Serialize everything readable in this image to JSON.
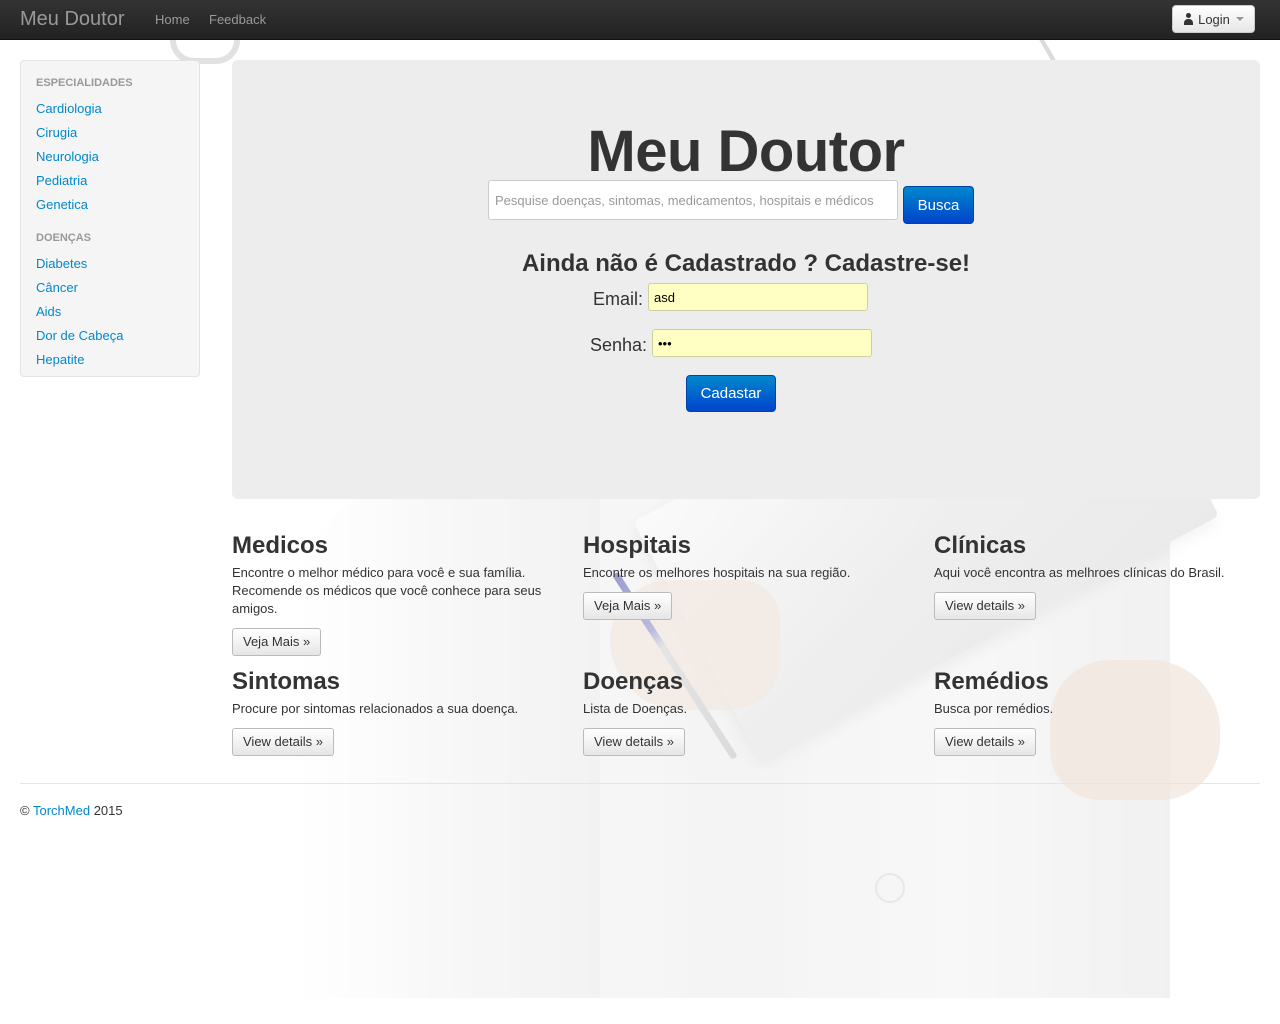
{
  "navbar": {
    "brand": "Meu Doutor",
    "links": [
      "Home",
      "Feedback"
    ],
    "login_label": "Login",
    "login_icon": "user-icon",
    "caret_icon": "caret-down-icon"
  },
  "sidebar": {
    "sections": [
      {
        "header": "ESPECIALIDADES",
        "items": [
          "Cardiologia",
          "Cirugia",
          "Neurologia",
          "Pediatria",
          "Genetica"
        ]
      },
      {
        "header": "DOENÇAS",
        "items": [
          "Diabetes",
          "Câncer",
          "Aids",
          "Dor de Cabeça",
          "Hepatite"
        ]
      }
    ]
  },
  "hero": {
    "title": "Meu Doutor",
    "search_placeholder": "Pesquise doenças, sintomas, medicamentos, hospitais e médicos",
    "search_button": "Busca",
    "cta_heading": "Ainda não é Cadastrado ? Cadastre-se!",
    "email_label": "Email:",
    "email_value": "asd",
    "senha_label": "Senha:",
    "senha_value": "•••",
    "submit_label": "Cadastar"
  },
  "features": [
    {
      "title": "Medicos",
      "text": "Encontre o melhor médico para você e sua família. Recomende os médicos que você conhece para seus amigos.",
      "button": "Veja Mais »"
    },
    {
      "title": "Hospitais",
      "text": "Encontre os melhores hospitais na sua região.",
      "button": "Veja Mais »"
    },
    {
      "title": "Clínicas",
      "text": "Aqui você encontra as melhroes clínicas do Brasil.",
      "button": "View details »"
    },
    {
      "title": "Sintomas",
      "text": "Procure por sintomas relacionados a sua doença.",
      "button": "View details »"
    },
    {
      "title": "Doenças",
      "text": "Lista de Doenças.",
      "button": "View details »"
    },
    {
      "title": "Remédios",
      "text": "Busca por remédios.",
      "button": "View details »"
    }
  ],
  "footer": {
    "copyright": "©",
    "link": "TorchMed",
    "year": "2015"
  },
  "colors": {
    "navbar": "#222222",
    "link": "#0088cc",
    "primary_button": "#0066cc",
    "autofill": "#ffffc4"
  }
}
